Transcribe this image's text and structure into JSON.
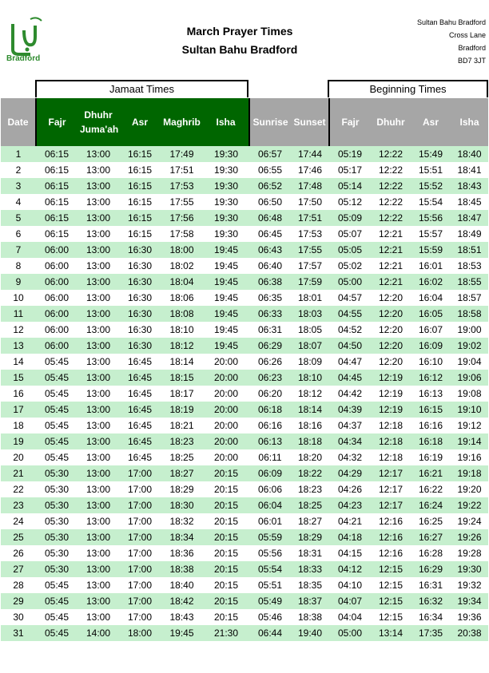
{
  "header": {
    "title": "March Prayer Times",
    "subtitle": "Sultan Bahu Bradford",
    "logo_text": "Bradford",
    "address": [
      "Sultan Bahu Bradford",
      "Cross Lane",
      "Bradford",
      "BD7 3JT"
    ]
  },
  "groups": {
    "jamaat": "Jamaat Times",
    "beginning": "Beginning Times"
  },
  "columns": [
    "Date",
    "Fajr",
    "Dhuhr Juma'ah",
    "Asr",
    "Maghrib",
    "Isha",
    "Sunrise",
    "Sunset",
    "Fajr",
    "Dhuhr",
    "Asr",
    "Isha"
  ],
  "rows": [
    [
      "1",
      "06:15",
      "13:00",
      "16:15",
      "17:49",
      "19:30",
      "06:57",
      "17:44",
      "05:19",
      "12:22",
      "15:49",
      "18:40"
    ],
    [
      "2",
      "06:15",
      "13:00",
      "16:15",
      "17:51",
      "19:30",
      "06:55",
      "17:46",
      "05:17",
      "12:22",
      "15:51",
      "18:41"
    ],
    [
      "3",
      "06:15",
      "13:00",
      "16:15",
      "17:53",
      "19:30",
      "06:52",
      "17:48",
      "05:14",
      "12:22",
      "15:52",
      "18:43"
    ],
    [
      "4",
      "06:15",
      "13:00",
      "16:15",
      "17:55",
      "19:30",
      "06:50",
      "17:50",
      "05:12",
      "12:22",
      "15:54",
      "18:45"
    ],
    [
      "5",
      "06:15",
      "13:00",
      "16:15",
      "17:56",
      "19:30",
      "06:48",
      "17:51",
      "05:09",
      "12:22",
      "15:56",
      "18:47"
    ],
    [
      "6",
      "06:15",
      "13:00",
      "16:15",
      "17:58",
      "19:30",
      "06:45",
      "17:53",
      "05:07",
      "12:21",
      "15:57",
      "18:49"
    ],
    [
      "7",
      "06:00",
      "13:00",
      "16:30",
      "18:00",
      "19:45",
      "06:43",
      "17:55",
      "05:05",
      "12:21",
      "15:59",
      "18:51"
    ],
    [
      "8",
      "06:00",
      "13:00",
      "16:30",
      "18:02",
      "19:45",
      "06:40",
      "17:57",
      "05:02",
      "12:21",
      "16:01",
      "18:53"
    ],
    [
      "9",
      "06:00",
      "13:00",
      "16:30",
      "18:04",
      "19:45",
      "06:38",
      "17:59",
      "05:00",
      "12:21",
      "16:02",
      "18:55"
    ],
    [
      "10",
      "06:00",
      "13:00",
      "16:30",
      "18:06",
      "19:45",
      "06:35",
      "18:01",
      "04:57",
      "12:20",
      "16:04",
      "18:57"
    ],
    [
      "11",
      "06:00",
      "13:00",
      "16:30",
      "18:08",
      "19:45",
      "06:33",
      "18:03",
      "04:55",
      "12:20",
      "16:05",
      "18:58"
    ],
    [
      "12",
      "06:00",
      "13:00",
      "16:30",
      "18:10",
      "19:45",
      "06:31",
      "18:05",
      "04:52",
      "12:20",
      "16:07",
      "19:00"
    ],
    [
      "13",
      "06:00",
      "13:00",
      "16:30",
      "18:12",
      "19:45",
      "06:29",
      "18:07",
      "04:50",
      "12:20",
      "16:09",
      "19:02"
    ],
    [
      "14",
      "05:45",
      "13:00",
      "16:45",
      "18:14",
      "20:00",
      "06:26",
      "18:09",
      "04:47",
      "12:20",
      "16:10",
      "19:04"
    ],
    [
      "15",
      "05:45",
      "13:00",
      "16:45",
      "18:15",
      "20:00",
      "06:23",
      "18:10",
      "04:45",
      "12:19",
      "16:12",
      "19:06"
    ],
    [
      "16",
      "05:45",
      "13:00",
      "16:45",
      "18:17",
      "20:00",
      "06:20",
      "18:12",
      "04:42",
      "12:19",
      "16:13",
      "19:08"
    ],
    [
      "17",
      "05:45",
      "13:00",
      "16:45",
      "18:19",
      "20:00",
      "06:18",
      "18:14",
      "04:39",
      "12:19",
      "16:15",
      "19:10"
    ],
    [
      "18",
      "05:45",
      "13:00",
      "16:45",
      "18:21",
      "20:00",
      "06:16",
      "18:16",
      "04:37",
      "12:18",
      "16:16",
      "19:12"
    ],
    [
      "19",
      "05:45",
      "13:00",
      "16:45",
      "18:23",
      "20:00",
      "06:13",
      "18:18",
      "04:34",
      "12:18",
      "16:18",
      "19:14"
    ],
    [
      "20",
      "05:45",
      "13:00",
      "16:45",
      "18:25",
      "20:00",
      "06:11",
      "18:20",
      "04:32",
      "12:18",
      "16:19",
      "19:16"
    ],
    [
      "21",
      "05:30",
      "13:00",
      "17:00",
      "18:27",
      "20:15",
      "06:09",
      "18:22",
      "04:29",
      "12:17",
      "16:21",
      "19:18"
    ],
    [
      "22",
      "05:30",
      "13:00",
      "17:00",
      "18:29",
      "20:15",
      "06:06",
      "18:23",
      "04:26",
      "12:17",
      "16:22",
      "19:20"
    ],
    [
      "23",
      "05:30",
      "13:00",
      "17:00",
      "18:30",
      "20:15",
      "06:04",
      "18:25",
      "04:23",
      "12:17",
      "16:24",
      "19:22"
    ],
    [
      "24",
      "05:30",
      "13:00",
      "17:00",
      "18:32",
      "20:15",
      "06:01",
      "18:27",
      "04:21",
      "12:16",
      "16:25",
      "19:24"
    ],
    [
      "25",
      "05:30",
      "13:00",
      "17:00",
      "18:34",
      "20:15",
      "05:59",
      "18:29",
      "04:18",
      "12:16",
      "16:27",
      "19:26"
    ],
    [
      "26",
      "05:30",
      "13:00",
      "17:00",
      "18:36",
      "20:15",
      "05:56",
      "18:31",
      "04:15",
      "12:16",
      "16:28",
      "19:28"
    ],
    [
      "27",
      "05:30",
      "13:00",
      "17:00",
      "18:38",
      "20:15",
      "05:54",
      "18:33",
      "04:12",
      "12:15",
      "16:29",
      "19:30"
    ],
    [
      "28",
      "05:45",
      "13:00",
      "17:00",
      "18:40",
      "20:15",
      "05:51",
      "18:35",
      "04:10",
      "12:15",
      "16:31",
      "19:32"
    ],
    [
      "29",
      "05:45",
      "13:00",
      "17:00",
      "18:42",
      "20:15",
      "05:49",
      "18:37",
      "04:07",
      "12:15",
      "16:32",
      "19:34"
    ],
    [
      "30",
      "05:45",
      "13:00",
      "17:00",
      "18:43",
      "20:15",
      "05:46",
      "18:38",
      "04:04",
      "12:15",
      "16:34",
      "19:36"
    ],
    [
      "31",
      "05:45",
      "14:00",
      "18:00",
      "19:45",
      "21:30",
      "06:44",
      "19:40",
      "05:00",
      "13:14",
      "17:35",
      "20:38"
    ]
  ],
  "colors": {
    "jamaat_header": "#006600",
    "header_grey": "#a6a6a6",
    "row_alt": "#c6efce",
    "logo_green": "#2e8b2e"
  }
}
